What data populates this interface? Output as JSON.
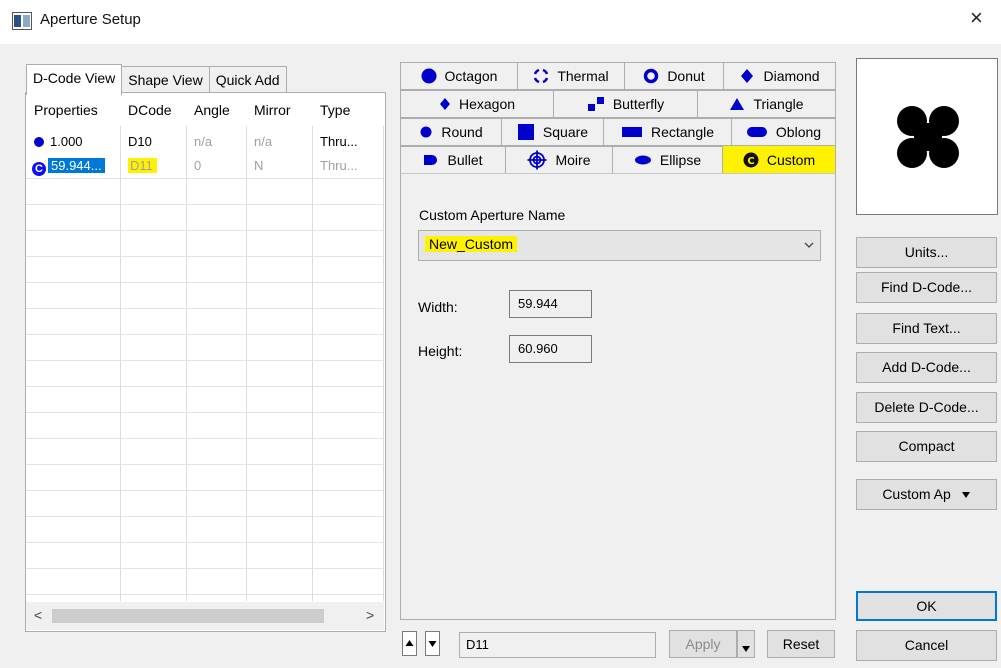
{
  "window": {
    "title": "Aperture Setup",
    "close_glyph": "×"
  },
  "left_tabs": [
    "D-Code View",
    "Shape View",
    "Quick Add"
  ],
  "table": {
    "columns": [
      "Properties",
      "DCode",
      "Angle",
      "Mirror",
      "Type"
    ],
    "rows": [
      {
        "properties": "1.000",
        "dcode": "D10",
        "angle": "n/a",
        "mirror": "n/a",
        "type": "Thru...",
        "icon": "round-dot-icon"
      },
      {
        "properties": "59.944...",
        "dcode": "D11",
        "angle": "0",
        "mirror": "N",
        "type": "Thru...",
        "icon": "custom-aperture-icon"
      }
    ]
  },
  "scrollbar": {
    "left_glyph": "<",
    "right_glyph": ">"
  },
  "shape_tabs": {
    "octagon": "Octagon",
    "thermal": "Thermal",
    "donut": "Donut",
    "diamond": "Diamond",
    "hexagon": "Hexagon",
    "butterfly": "Butterfly",
    "triangle": "Triangle",
    "round": "Round",
    "square": "Square",
    "rectangle": "Rectangle",
    "oblong": "Oblong",
    "bullet": "Bullet",
    "moire": "Moire",
    "ellipse": "Ellipse",
    "custom": "Custom"
  },
  "custom_panel": {
    "name_label": "Custom Aperture Name",
    "name_value": "New_Custom",
    "width_label": "Width:",
    "width_value": "59.944",
    "height_label": "Height:",
    "height_value": "60.960"
  },
  "bottom": {
    "dcode_value": "D11",
    "apply_label": "Apply",
    "reset_label": "Reset"
  },
  "right_buttons": {
    "units": "Units...",
    "find_dcode": "Find D-Code...",
    "find_text": "Find Text...",
    "add_dcode": "Add D-Code...",
    "delete_dcode": "Delete D-Code...",
    "compact": "Compact",
    "custom_ap": "Custom Ap",
    "ok": "OK",
    "cancel": "Cancel"
  },
  "colors": {
    "accent_blue": "#0000cc",
    "highlight": "#fff200",
    "selection": "#0078d7"
  }
}
